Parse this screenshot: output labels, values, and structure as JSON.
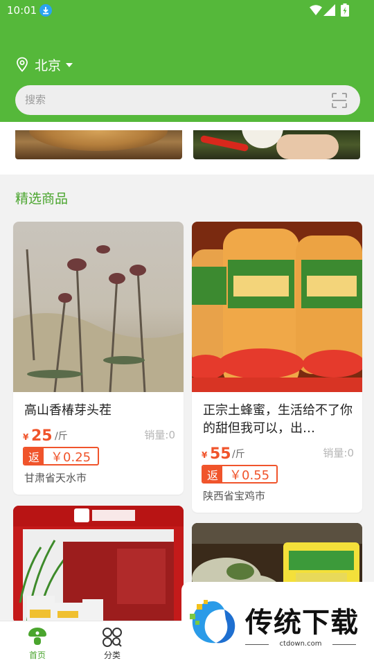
{
  "status_bar": {
    "time": "10:01"
  },
  "header": {
    "city": "北京"
  },
  "search": {
    "placeholder": "搜索"
  },
  "section": {
    "title": "精选商品"
  },
  "products": [
    {
      "name": "高山香椿芽头茬",
      "currency": "¥",
      "price": "25",
      "unit": "/斤",
      "sales": "销量:0",
      "rebate_tag": "返",
      "rebate_value": "￥0.25",
      "origin": "甘肃省天水市"
    },
    {
      "name": "正宗土蜂蜜，生活给不了你的甜但我可以，出…",
      "currency": "¥",
      "price": "55",
      "unit": "/斤",
      "sales": "销量:0",
      "rebate_tag": "返",
      "rebate_value": "￥0.55",
      "origin": "陕西省宝鸡市"
    }
  ],
  "tabbar": {
    "items": [
      {
        "label": "首页",
        "icon": "home-icon",
        "active": true
      },
      {
        "label": "分类",
        "icon": "category-icon",
        "active": false
      }
    ],
    "active_color": "#4aa52e",
    "inactive_color": "#333333"
  },
  "watermark": {
    "text": "传统下载",
    "url": "ctdown.com"
  },
  "colors": {
    "brand_green": "#55b83a",
    "price_red": "#f0542b"
  }
}
